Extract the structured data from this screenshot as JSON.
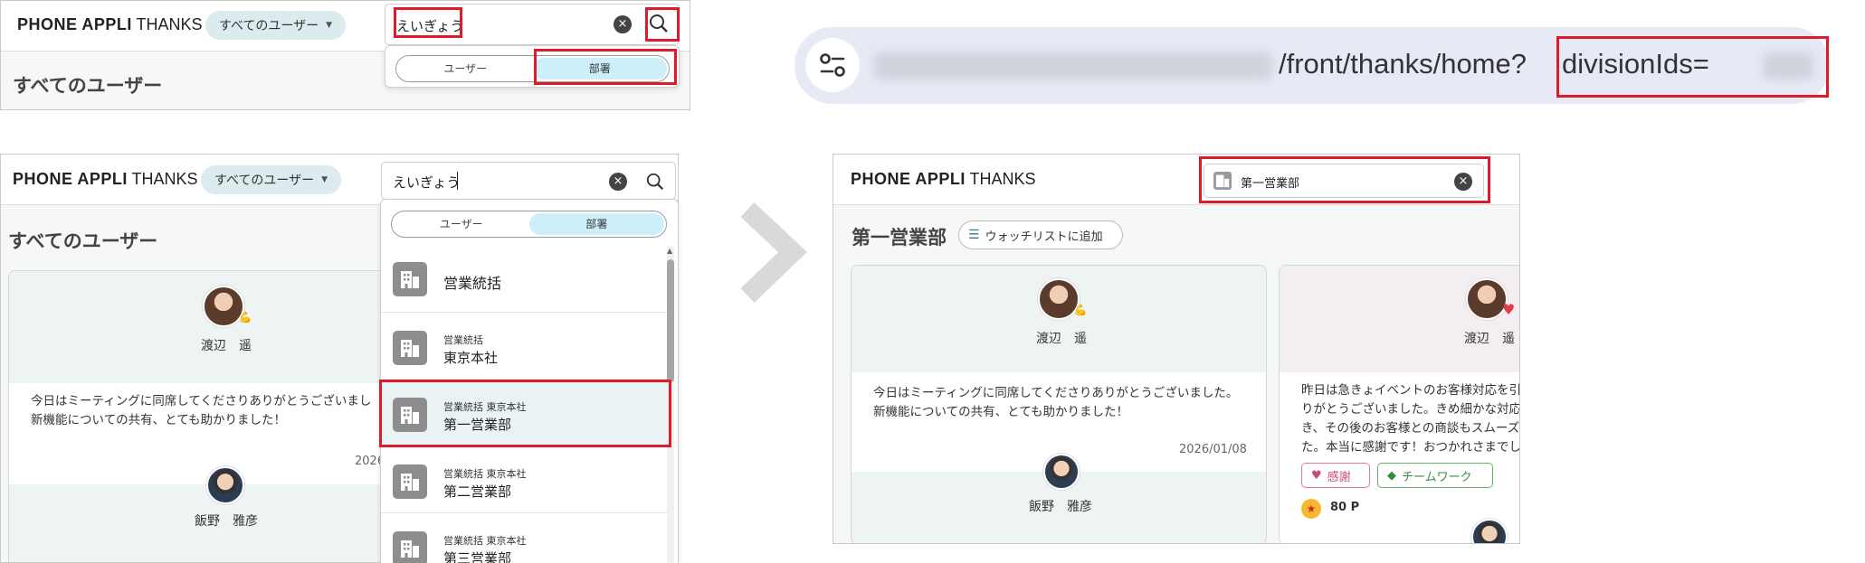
{
  "colors": {
    "highlight_red": "#dd1b2a",
    "tab_active": "#cdeffa",
    "pill_bg": "#dcebed",
    "arrow_gray": "#d9d9d9"
  },
  "app": {
    "brand_bold": "PHONE APPLI",
    "brand_light": "THANKS"
  },
  "user_filter": {
    "label": "すべてのユーザー"
  },
  "search": {
    "query": "えいぎょう",
    "selected_division": "第一営業部"
  },
  "tabs": {
    "user": "ユーザー",
    "division": "部署"
  },
  "page": {
    "title_all": "すべてのユーザー",
    "title_division": "第一営業部",
    "watchlist_button": "ウォッチリストに追加"
  },
  "dropdown": {
    "items": [
      {
        "path": "",
        "name": "営業統括"
      },
      {
        "path": "営業統括",
        "name": "東京本社"
      },
      {
        "path": "営業統括 東京本社",
        "name": "第一営業部"
      },
      {
        "path": "営業統括 東京本社",
        "name": "第二営業部"
      },
      {
        "path": "営業統括 東京本社",
        "name": "第三営業部"
      }
    ]
  },
  "url_bar": {
    "path": "/front/thanks/home?",
    "param": "divisionIds="
  },
  "cards": {
    "card1": {
      "sender": "渡辺　遥",
      "message_line1": "今日はミーティングに同席してくださりありがとうございました。",
      "message_line2": "新機能についての共有、とても助かりました！",
      "message_line1_cut": "今日はミーティングに同席してくださりありがとうございまし",
      "date": "2026/01/08",
      "date_cut": "2026",
      "receiver": "飯野　雅彦",
      "sender_badge": "💪"
    },
    "card2": {
      "sender": "渡辺　遥",
      "message_line1": "昨日は急きょイベントのお客様対応を引",
      "message_line2": "りがとうございました。きめ細かな対応",
      "message_line3": "き、その後のお客様との商談もスムーズ",
      "message_line4": "た。本当に感謝です！おつかれさまでし",
      "tag1": "感謝",
      "tag2": "チームワーク",
      "points": "80 P",
      "sender_badge": "♥"
    }
  }
}
